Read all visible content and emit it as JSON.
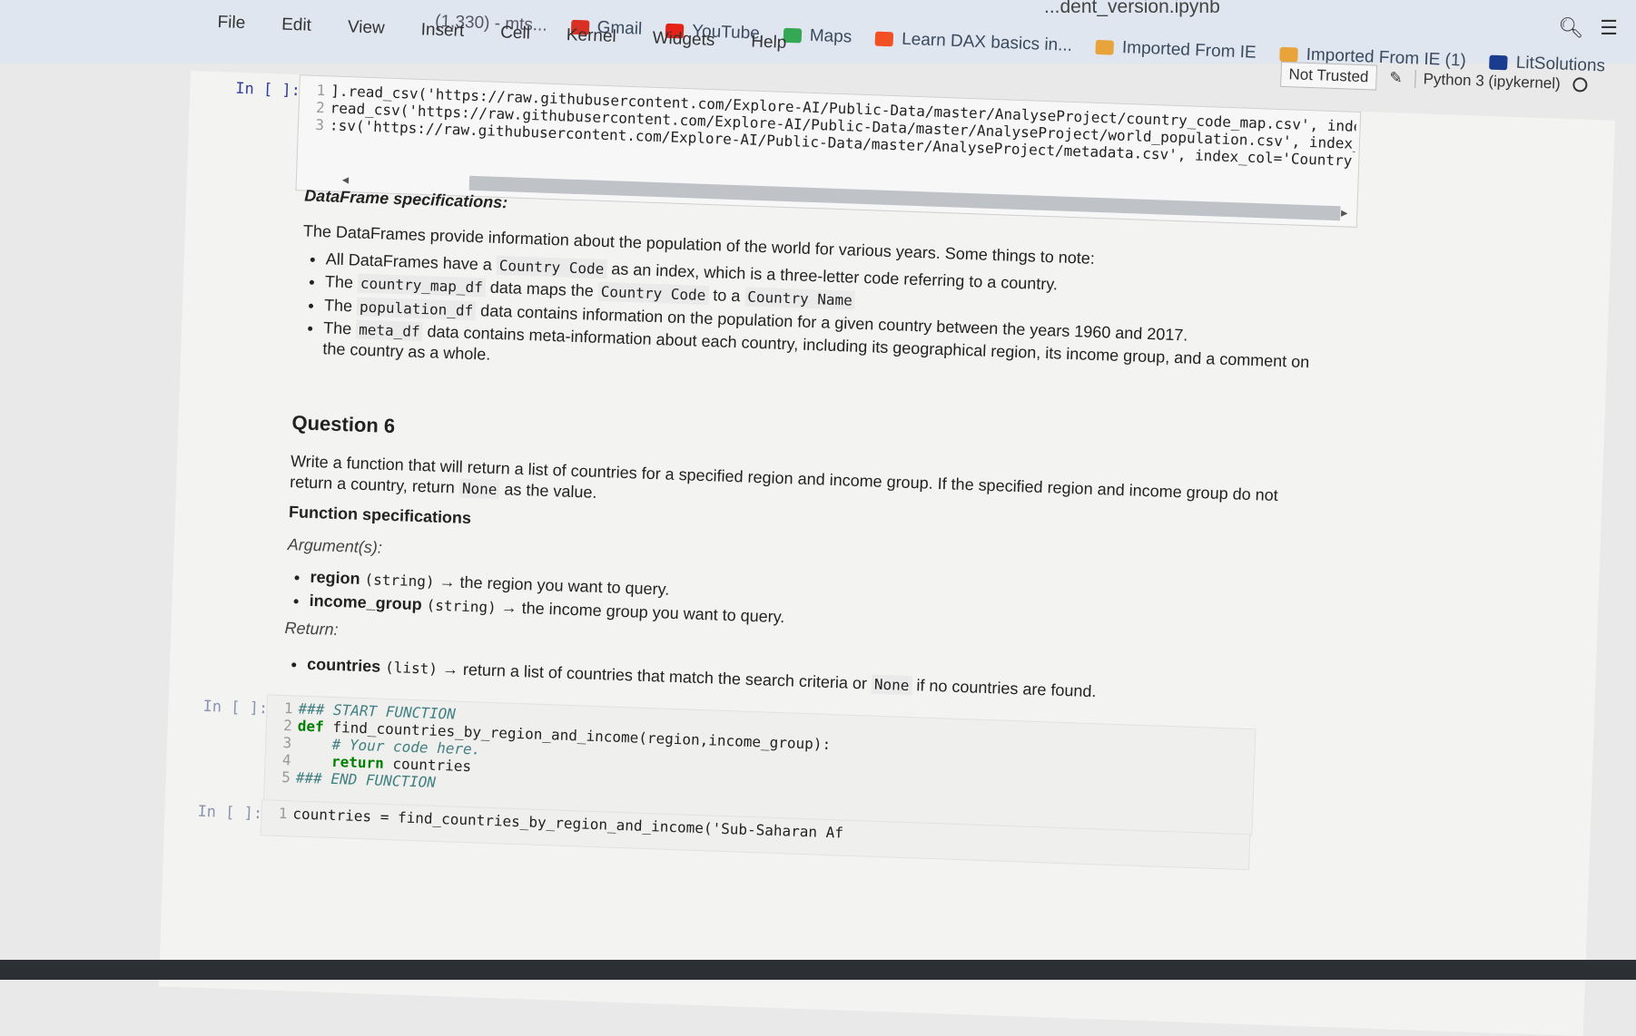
{
  "browser": {
    "tab_fragment": "(1,330) - mts...",
    "filename": "...dent_version.ipynb",
    "bookmarks": [
      {
        "label": "Gmail",
        "color": "#d93025"
      },
      {
        "label": "YouTube",
        "color": "#e62117"
      },
      {
        "label": "Maps",
        "color": "#34a853"
      },
      {
        "label": "Learn DAX basics in...",
        "color": "#f25022"
      },
      {
        "label": "Imported From IE",
        "color": "#e8a33a"
      },
      {
        "label": "Imported From IE (1)",
        "color": "#e8a33a"
      },
      {
        "label": "LitSolutions",
        "color": "#1a3c8f"
      }
    ],
    "icons": [
      "search-icon",
      "extension-icon"
    ]
  },
  "menu": [
    "File",
    "Edit",
    "View",
    "Insert",
    "Cell",
    "Kernel",
    "Widgets",
    "Help"
  ],
  "kernel": {
    "trusted_label": "Not Trusted",
    "kernel_label": "Python 3 (ipykernel)"
  },
  "cell1": {
    "prompt": "In [ ]:",
    "lines": [
      {
        "n": "1",
        "text": "].read_csv('https://raw.githubusercontent.com/Explore-AI/Public-Data/master/AnalyseProject/country_code_map.csv', index_col='"
      },
      {
        "n": "2",
        "text": "read_csv('https://raw.githubusercontent.com/Explore-AI/Public-Data/master/AnalyseProject/world_population.csv', index_col='C"
      },
      {
        "n": "3",
        "text": ":sv('https://raw.githubusercontent.com/Explore-AI/Public-Data/master/AnalyseProject/metadata.csv', index_col='Country Code')"
      }
    ]
  },
  "md1": {
    "heading": "DataFrame specifications:",
    "intro": "The DataFrames provide information about the population of the world for various years. Some things to note:",
    "b1_pre": "All DataFrames have a",
    "b1_code": "Country Code",
    "b1_post": "as an index, which is a three-letter code referring to a country.",
    "b2_pre": "The",
    "b2_code": "country_map_df",
    "b2_mid": "data maps the",
    "b2_code2": "Country Code",
    "b2_mid2": "to a",
    "b2_code3": "Country Name",
    "b3_pre": "The",
    "b3_code": "population_df",
    "b3_post": "data contains information on the population for a given country between the years 1960 and 2017.",
    "b4_pre": "The",
    "b4_code": "meta_df",
    "b4_post": "data contains meta-information about each country, including its geographical region, its income group, and a comment on the country as a whole."
  },
  "md2": {
    "heading": "Question 6",
    "desc": "Write a function that will return a list of countries for a specified region and income group. If the specified region and income group do not return a country, return",
    "desc_code": "None",
    "desc_end": "as the value.",
    "func_spec": "Function specifications",
    "args_label": "Argument(s):",
    "arg1_name": "region",
    "arg1_type": "(string)",
    "arg1_desc": "→ the region you want to query.",
    "arg2_name": "income_group",
    "arg2_type": "(string)",
    "arg2_desc": "→ the income group you want to query.",
    "return_label": "Return:",
    "ret_name": "countries",
    "ret_type": "(list)",
    "ret_desc": "→ return a list of countries that match the search criteria or",
    "ret_code": "None",
    "ret_end": "if no countries are found."
  },
  "cell2": {
    "prompt": "In [ ]:",
    "l1": "### START FUNCTION",
    "l2_kw": "def",
    "l2_rest": "find_countries_by_region_and_income(region,income_group):",
    "l3": "# Your code here.",
    "l4_kw": "return",
    "l4_rest": "countries",
    "l5": "### END FUNCTION"
  },
  "cell3": {
    "prompt": "In [ ]:",
    "line": "countries = find_countries_by_region_and_income('Sub-Saharan Af"
  }
}
